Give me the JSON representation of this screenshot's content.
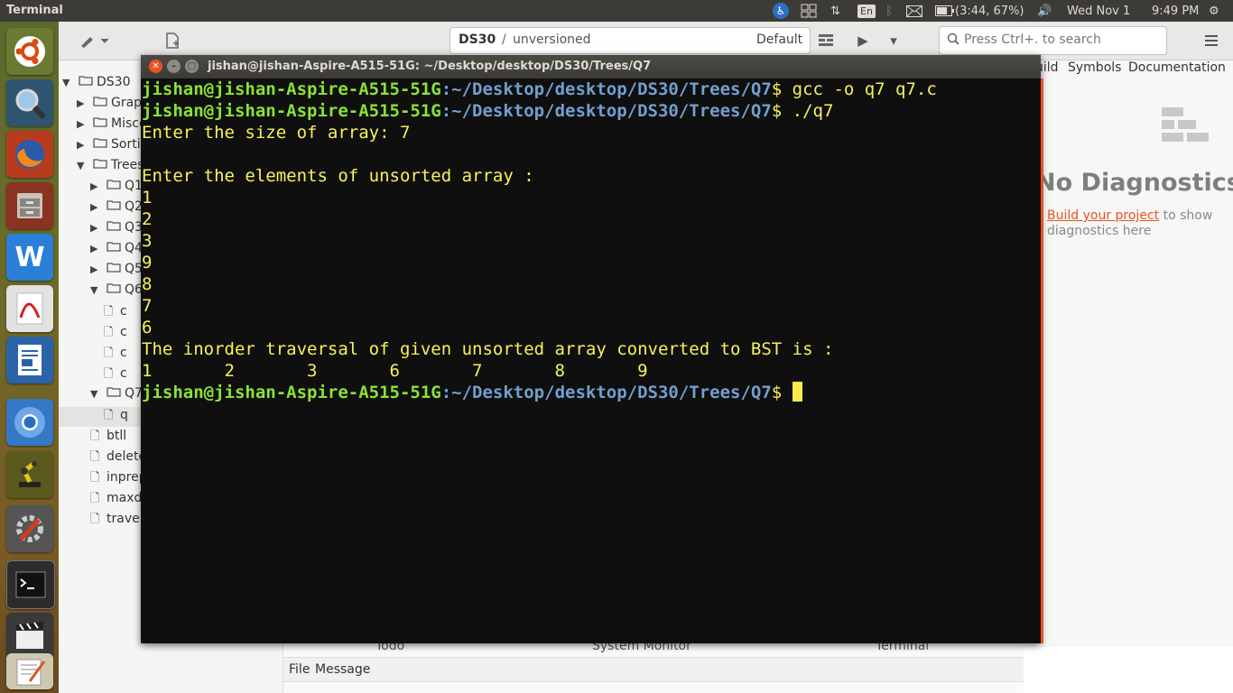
{
  "panel": {
    "app_title": "Terminal",
    "battery": "(3:44, 67%)",
    "keyboard": "En",
    "date": "Wed Nov  1",
    "time": "9:49 PM"
  },
  "launcher": {
    "items": [
      "ubuntu-dash",
      "search-lens",
      "firefox",
      "files",
      "wps-writer",
      "pdf-reader",
      "libreoffice-writer",
      "chromium",
      "robot-app",
      "system-settings",
      "terminal",
      "video-editor",
      "text-editor"
    ]
  },
  "builder": {
    "project_name": "DS30",
    "vcs_status": "unversioned",
    "build_profile": "Default",
    "search_placeholder": "Press Ctrl+. to search",
    "right_tabs": [
      "uild",
      "Symbols",
      "Documentation"
    ],
    "no_diag_title": "No Diagnostics",
    "no_diag_link": "Build your project",
    "no_diag_text1": " to show",
    "no_diag_text2": "diagnostics here",
    "bottom_tabs": [
      "Todo",
      "System Monitor",
      "Terminal"
    ],
    "bottom_headers": [
      "File",
      "Message"
    ],
    "tree": [
      {
        "label": "DS30",
        "depth": 0,
        "arrow": "down"
      },
      {
        "label": "Grap",
        "depth": 1,
        "arrow": "right"
      },
      {
        "label": "Misce",
        "depth": 1,
        "arrow": "right"
      },
      {
        "label": "Sortir",
        "depth": 1,
        "arrow": "right"
      },
      {
        "label": "Trees",
        "depth": 1,
        "arrow": "down"
      },
      {
        "label": "Q1",
        "depth": 2,
        "arrow": "right"
      },
      {
        "label": "Q2",
        "depth": 2,
        "arrow": "right"
      },
      {
        "label": "Q3",
        "depth": 2,
        "arrow": "right"
      },
      {
        "label": "Q4",
        "depth": 2,
        "arrow": "right"
      },
      {
        "label": "Q5",
        "depth": 2,
        "arrow": "right"
      },
      {
        "label": "Q6",
        "depth": 2,
        "arrow": "down"
      },
      {
        "label": "c",
        "depth": 3,
        "arrow": "file"
      },
      {
        "label": "c",
        "depth": 3,
        "arrow": "file"
      },
      {
        "label": "c",
        "depth": 3,
        "arrow": "file"
      },
      {
        "label": "c",
        "depth": 3,
        "arrow": "file"
      },
      {
        "label": "Q7",
        "depth": 2,
        "arrow": "down"
      },
      {
        "label": "q",
        "depth": 3,
        "arrow": "file"
      },
      {
        "label": "btll",
        "depth": 2,
        "arrow": "file"
      },
      {
        "label": "deleteBST.c",
        "depth": 2,
        "arrow": "file"
      },
      {
        "label": "inprepostNR.c",
        "depth": 2,
        "arrow": "file"
      },
      {
        "label": "maxdepthbst.c",
        "depth": 2,
        "arrow": "file"
      },
      {
        "label": "traversalsALL.c",
        "depth": 2,
        "arrow": "file"
      }
    ]
  },
  "terminal": {
    "window_title": "jishan@jishan-Aspire-A515-51G: ~/Desktop/desktop/DS30/Trees/Q7",
    "prompt_user": "jishan@jishan-Aspire-A515-51G",
    "prompt_path": ":~/Desktop/desktop/DS30/Trees/Q7",
    "cmd1": "$ gcc -o q7 q7.c",
    "cmd2": "$ ./q7",
    "out_size": "Enter the size of array: 7",
    "out_blank": "",
    "out_enter": "Enter the elements of unsorted array :",
    "inputs": [
      "1",
      "2",
      "3",
      "9",
      "8",
      "7",
      "6"
    ],
    "out_result": "The inorder traversal of given unsorted array converted to BST is :",
    "out_values": "1       2       3       6       7       8       9",
    "final_prompt_suffix": "$ "
  }
}
